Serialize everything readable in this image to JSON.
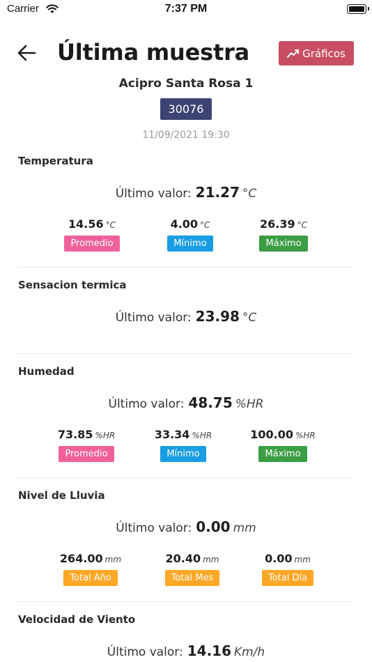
{
  "status_bar": {
    "carrier": "Carrier",
    "time": "7:37 PM"
  },
  "header": {
    "title": "Última muestra",
    "graficos_label": "Gráficos",
    "graficos_color": "#c84d63"
  },
  "station": {
    "name": "Acipro Santa Rosa 1",
    "code": "30076",
    "code_bg": "#3d4473",
    "timestamp": "11/09/2021 19:30"
  },
  "last_label": "Último valor:",
  "sections": {
    "temperatura": {
      "title": "Temperatura",
      "last_value": "21.27",
      "unit": "°C",
      "stats": [
        {
          "value": "14.56",
          "unit": "°C",
          "label": "Promedio"
        },
        {
          "value": "4.00",
          "unit": "°C",
          "label": "Mínimo"
        },
        {
          "value": "26.39",
          "unit": "°C",
          "label": "Máximo"
        }
      ]
    },
    "sensacion": {
      "title": "Sensacion termica",
      "last_value": "23.98",
      "unit": "°C"
    },
    "humedad": {
      "title": "Humedad",
      "last_value": "48.75",
      "unit": "%HR",
      "stats": [
        {
          "value": "73.85",
          "unit": "%HR",
          "label": "Promedio"
        },
        {
          "value": "33.34",
          "unit": "%HR",
          "label": "Mínimo"
        },
        {
          "value": "100.00",
          "unit": "%HR",
          "label": "Máximo"
        }
      ]
    },
    "lluvia": {
      "title": "Nivel de Lluvia",
      "last_value": "0.00",
      "unit": "mm",
      "stats": [
        {
          "value": "264.00",
          "unit": "mm",
          "label": "Total Año"
        },
        {
          "value": "20.40",
          "unit": "mm",
          "label": "Total Mes"
        },
        {
          "value": "0.00",
          "unit": "mm",
          "label": "Total Día"
        }
      ]
    },
    "viento": {
      "title": "Velocidad de Viento",
      "last_value": "14.16",
      "unit": "Km/h"
    }
  },
  "badge_colors": {
    "promedio": "#f0619a",
    "minimo": "#199ee3",
    "maximo": "#3b9e44",
    "totals": "#ffa726"
  }
}
